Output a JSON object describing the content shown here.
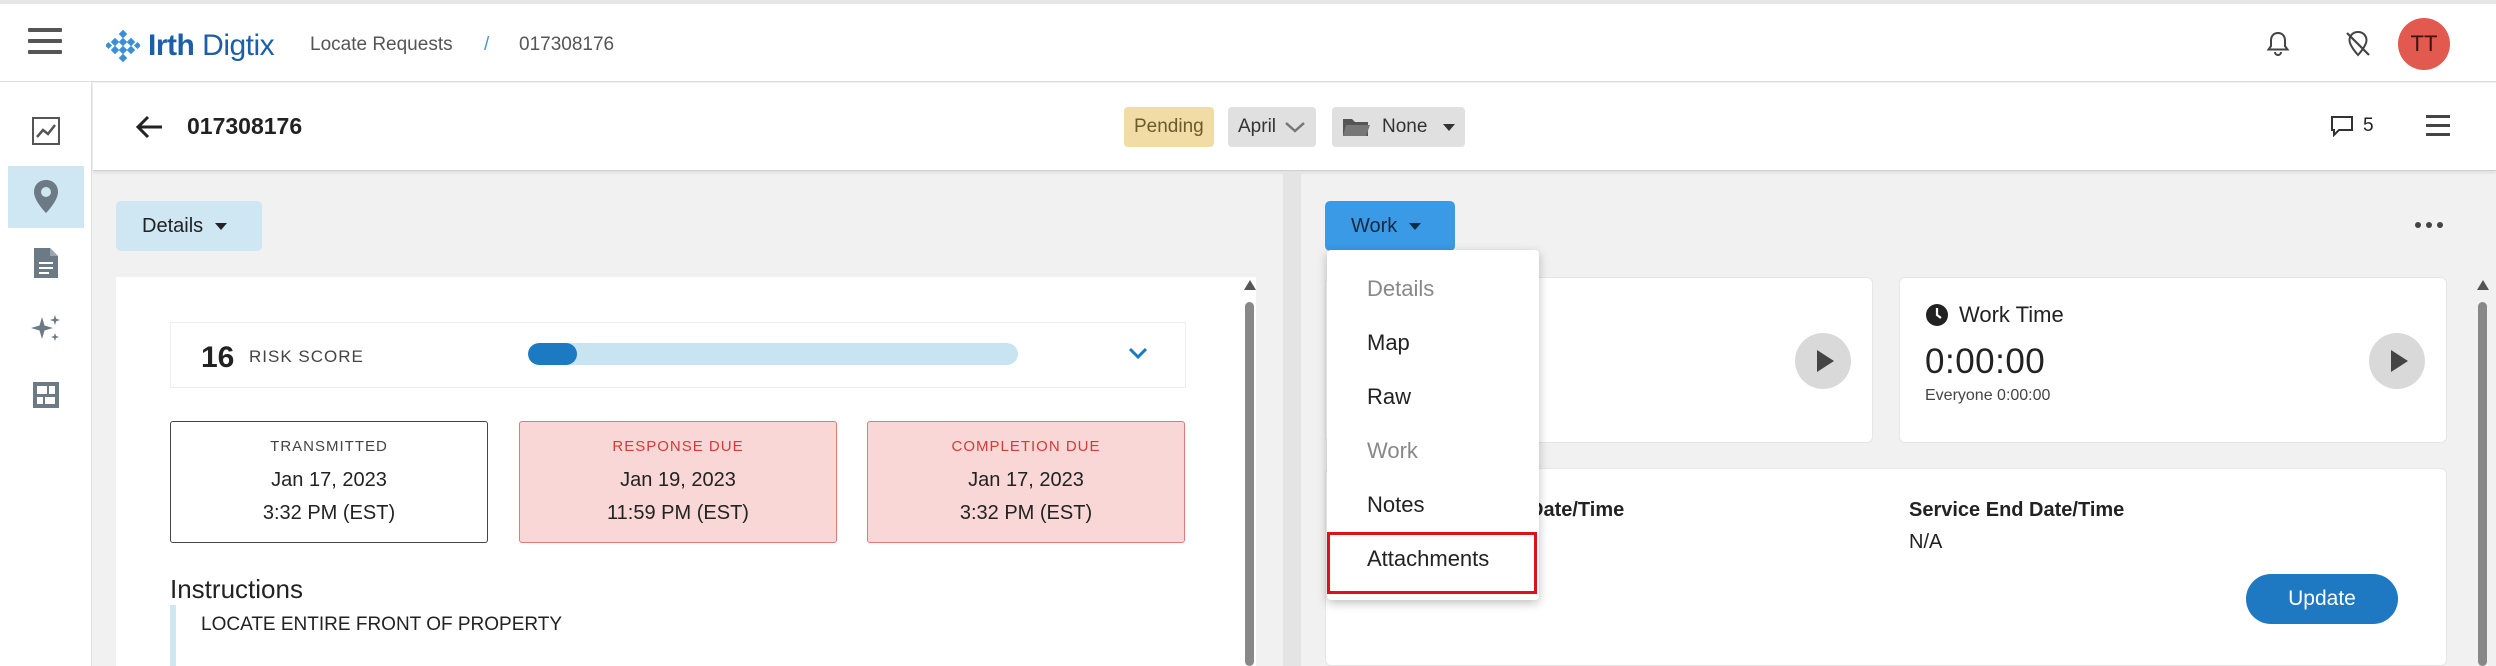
{
  "app": {
    "logo_text_bold": "Irth",
    "logo_text": " Digtix"
  },
  "breadcrumb": {
    "section": "Locate Requests",
    "separator": "/",
    "current": "017308176"
  },
  "user": {
    "initials": "TT",
    "avatar_color": "#e2594f"
  },
  "subheader": {
    "title": "017308176",
    "status": "Pending",
    "month": "April",
    "folder": "None",
    "comment_count": "5"
  },
  "left_panel": {
    "tab_label": "Details",
    "risk": {
      "score": "16",
      "label": "RISK SCORE",
      "fraction": 0.1
    },
    "dates": [
      {
        "label": "TRANSMITTED",
        "date": "Jan 17, 2023",
        "time": "3:32 PM (EST)",
        "alert": false
      },
      {
        "label": "RESPONSE DUE",
        "date": "Jan 19, 2023",
        "time": "11:59 PM (EST)",
        "alert": true
      },
      {
        "label": "COMPLETION DUE",
        "date": "Jan 17, 2023",
        "time": "3:32 PM (EST)",
        "alert": true
      }
    ],
    "instructions_title": "Instructions",
    "instructions_text": "LOCATE ENTIRE FRONT OF PROPERTY"
  },
  "right_panel": {
    "tab_label": "Work",
    "work_time": {
      "title": "Work Time",
      "value": "0:00:00",
      "sub": "Everyone 0:00:00"
    },
    "service_start_label": "Date/Time",
    "service_end_label": "Service End Date/Time",
    "service_end_value": "N/A",
    "update_label": "Update"
  },
  "dropdown": {
    "items": [
      {
        "label": "Details",
        "disabled": true
      },
      {
        "label": "Map",
        "disabled": false
      },
      {
        "label": "Raw",
        "disabled": false
      },
      {
        "label": "Work",
        "disabled": true
      },
      {
        "label": "Notes",
        "disabled": false
      },
      {
        "label": "Attachments",
        "disabled": false,
        "highlighted": true
      }
    ]
  },
  "colors": {
    "accent": "#3a9ae6",
    "brand": "#1c5fa8",
    "alert_bg": "#f8d7d6",
    "alert_text": "#d33b36",
    "pending": "#f1dca6"
  }
}
